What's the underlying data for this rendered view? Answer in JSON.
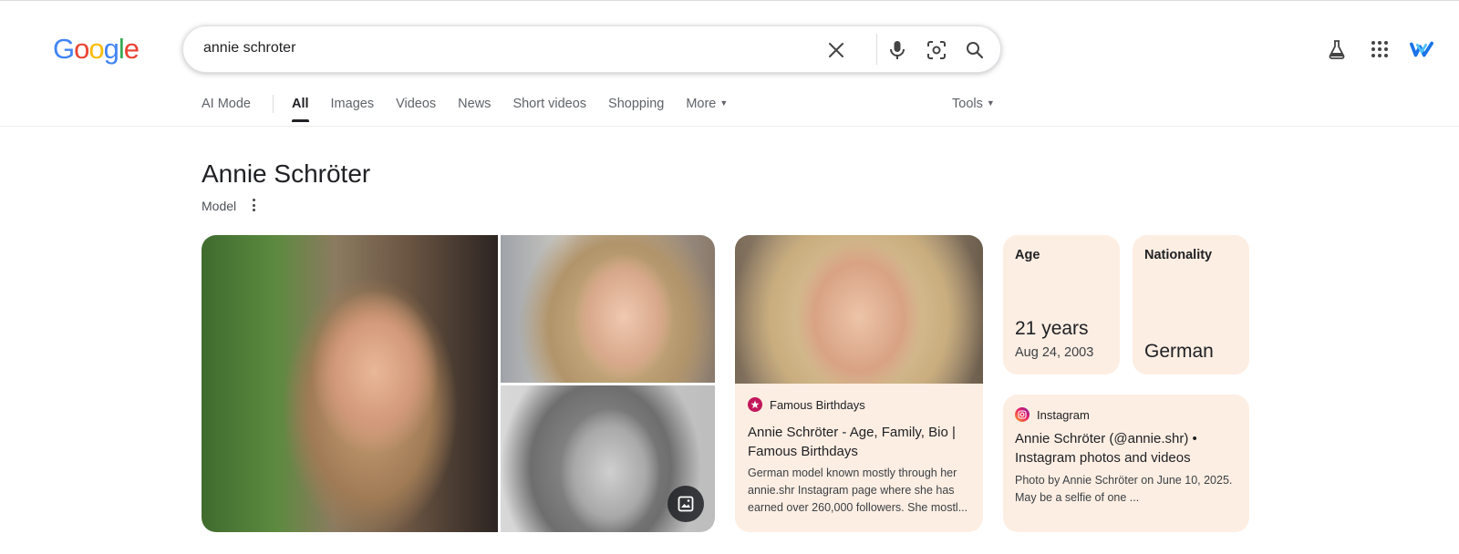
{
  "header": {
    "logo_letters": [
      {
        "ch": "G",
        "color": "#4285F4"
      },
      {
        "ch": "o",
        "color": "#EA4335"
      },
      {
        "ch": "o",
        "color": "#FBBC05"
      },
      {
        "ch": "g",
        "color": "#4285F4"
      },
      {
        "ch": "l",
        "color": "#34A853"
      },
      {
        "ch": "e",
        "color": "#EA4335"
      }
    ],
    "search_query": "annie schroter",
    "icons": [
      "clear-icon",
      "microphone-icon",
      "lens-icon",
      "search-icon",
      "labs-flask-icon",
      "apps-grid-icon",
      "account-avatar-icon"
    ]
  },
  "tabs": [
    {
      "label": "AI Mode",
      "active": false
    },
    {
      "label": "All",
      "active": true
    },
    {
      "label": "Images",
      "active": false
    },
    {
      "label": "Videos",
      "active": false
    },
    {
      "label": "News",
      "active": false
    },
    {
      "label": "Short videos",
      "active": false
    },
    {
      "label": "Shopping",
      "active": false
    },
    {
      "label": "More",
      "active": false
    }
  ],
  "tools_label": "Tools",
  "entity": {
    "name": "Annie Schröter",
    "subtitle": "Model"
  },
  "famous_birthdays": {
    "source": "Famous Birthdays",
    "title": "Annie Schröter - Age, Family, Bio | Famous Birthdays",
    "snippet": "German model known mostly through her annie.shr Instagram page where she has earned over 260,000 followers. She mostl..."
  },
  "facts": {
    "age": {
      "label": "Age",
      "value": "21 years",
      "detail": "Aug 24, 2003"
    },
    "nationality": {
      "label": "Nationality",
      "value": "German"
    }
  },
  "instagram": {
    "source": "Instagram",
    "title": "Annie Schröter (@annie.shr) • Instagram photos and videos",
    "snippet": "Photo by Annie Schröter on June 10, 2025. May be a selfie of one ..."
  },
  "colors": {
    "card_bg": "#fdeee3",
    "text_primary": "#202124",
    "text_secondary": "#5f6368"
  }
}
